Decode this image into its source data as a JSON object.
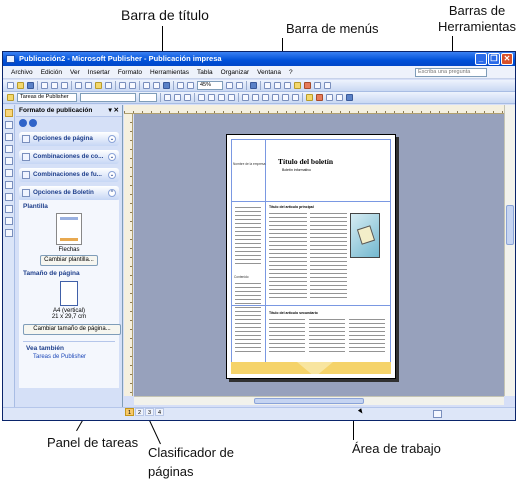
{
  "callouts": {
    "title_bar": "Barra de título",
    "menu_bar": "Barra de menús",
    "toolbars_1": "Barras de",
    "toolbars_2": "Herramientas",
    "task_pane": "Panel de tareas",
    "page_sorter_1": "Clasificador de",
    "page_sorter_2": "páginas",
    "work_area": "Área de trabajo"
  },
  "window": {
    "title": "Publicación2 - Microsoft Publisher - Publicación impresa",
    "controls": [
      "minimize-icon",
      "restore-icon",
      "close-icon"
    ]
  },
  "menu": {
    "items": [
      "Archivo",
      "Edición",
      "Ver",
      "Insertar",
      "Formato",
      "Herramientas",
      "Tabla",
      "Organizar",
      "Ventana",
      "?"
    ],
    "help_placeholder": "Escriba una pregunta"
  },
  "toolbar": {
    "style_combo": "Tareas de Publisher",
    "zoom": "45%"
  },
  "task_pane": {
    "title": "Formato de publicación",
    "sections": [
      "Opciones de página",
      "Combinaciones de co...",
      "Combinaciones de fu...",
      "Opciones de Boletín"
    ],
    "template_label": "Plantilla",
    "template_name": "Flechas",
    "change_template_button": "Cambiar plantilla...",
    "page_size_label": "Tamaño de página",
    "page_size_name": "A4 (vertical)",
    "page_size_dims": "21 x 29,7 cm",
    "change_page_size_button": "Cambiar tamaño de página...",
    "see_also_label": "Vea también",
    "see_also_link": "Tareas de Publisher"
  },
  "newsletter": {
    "title": "Título del boletín",
    "subtitle": "Boletín informativo",
    "org_name": "Nombre de la empresa",
    "main_story": "Título del artículo principal",
    "secondary_story": "Título del artículo secundario",
    "contents_label": "Contenido"
  },
  "page_sorter": {
    "pages": [
      "1",
      "2",
      "3",
      "4"
    ],
    "active_page": "1"
  }
}
